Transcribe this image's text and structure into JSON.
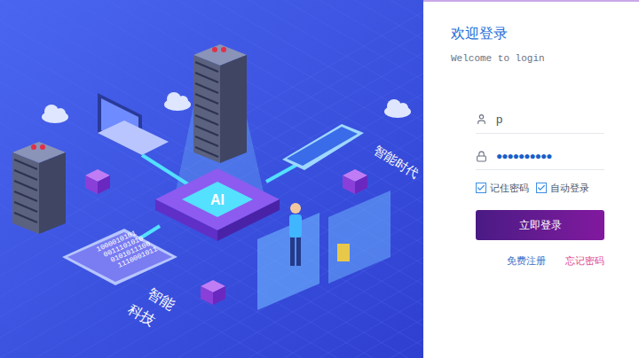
{
  "header": {
    "title": "欢迎登录",
    "subtitle": "Welcome to login"
  },
  "form": {
    "username": {
      "value": "p"
    },
    "password": {
      "value": "●●●●●●●●●●"
    },
    "checkboxes": [
      {
        "label": "记住密码",
        "checked": true
      },
      {
        "label": "自动登录",
        "checked": true
      }
    ],
    "submit": "立即登录",
    "links": [
      {
        "label": "免费注册",
        "color": "#3a73c8"
      },
      {
        "label": "忘记密码",
        "color": "#e0468c"
      }
    ]
  },
  "illustration": {
    "tag": "智能时代",
    "slogan_lines": [
      "智能",
      "科技"
    ],
    "chip": "AI",
    "binary": [
      "1000010101",
      "0011101010",
      "0101011100",
      "1110001011"
    ]
  }
}
